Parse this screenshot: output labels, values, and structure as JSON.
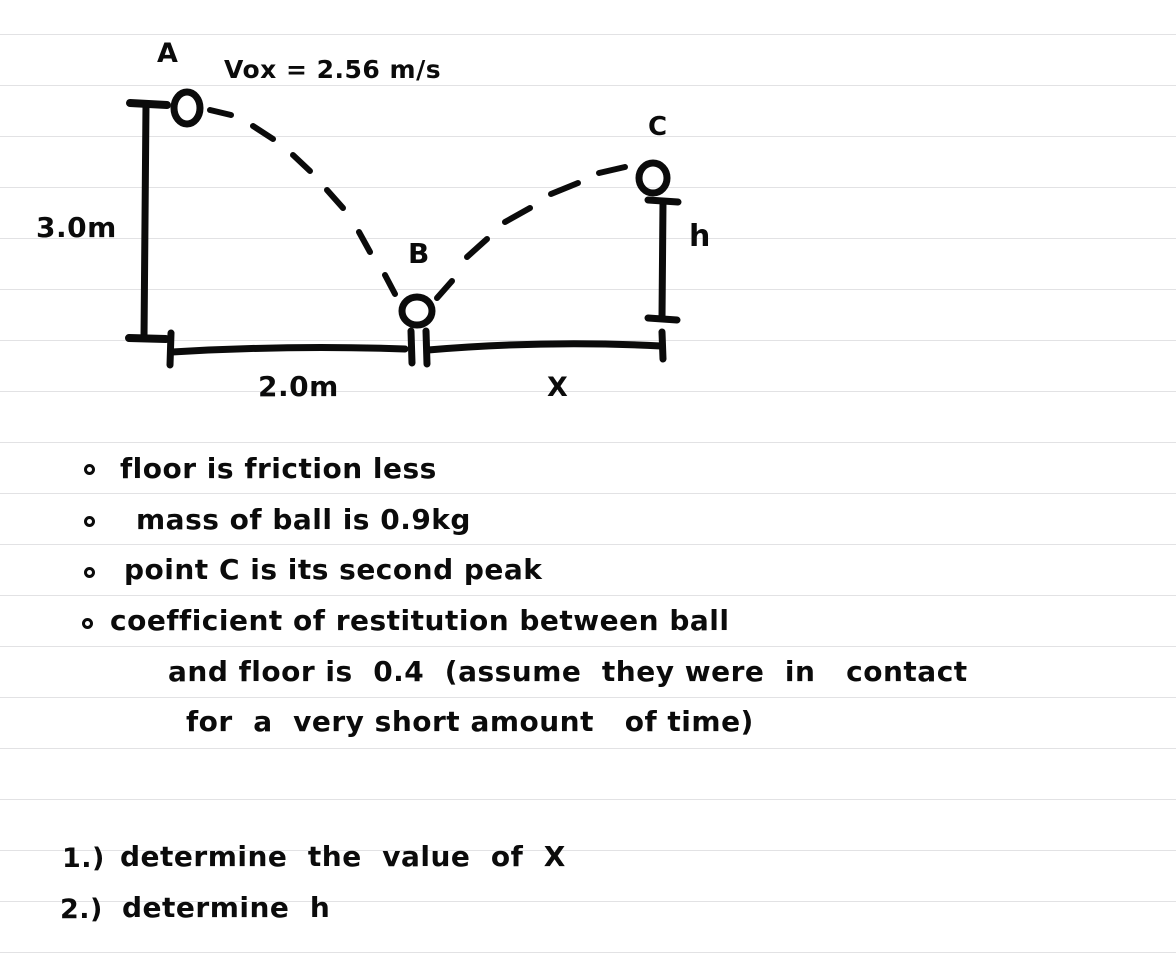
{
  "document": {
    "kind": "handwritten-notebook-page",
    "background_color": "#ffffff",
    "ink_color": "#0b0b0b",
    "rule_color": "#e2e2e4",
    "rule_spacing_px": 51
  },
  "diagram": {
    "title": "projectile bouncing off frictionless floor",
    "labels": {
      "point_a": "A",
      "point_b": "B",
      "point_c": "C",
      "initial_velocity": "Vox = 2.56 m/s",
      "drop_height": "3.0m",
      "horizontal_run_ab": "2.0m",
      "horizontal_run_bc": "X",
      "bounce_height": "h"
    },
    "balls": [
      {
        "name": "ball-a",
        "label": "A"
      },
      {
        "name": "ball-b",
        "label": "B"
      },
      {
        "name": "ball-c",
        "label": "C"
      }
    ]
  },
  "given": {
    "heading": "",
    "bullets": [
      "floor is friction less",
      "mass of ball is 0.9kg",
      "point C is its second peak",
      "coefficient of restitution between ball"
    ],
    "bullet4_lines": [
      "and floor is  0.4  (assume  they were  in   contact",
      "for  a  very short amount   of time)"
    ]
  },
  "questions": [
    {
      "number": "1.)",
      "text": "determine  the  value  of  X"
    },
    {
      "number": "2.)",
      "text": "determine  h"
    }
  ],
  "values": {
    "vox": "2.56 m/s",
    "drop_height": "3.0m",
    "run": "2.0m",
    "mass": "0.9kg",
    "restitution": "0.4"
  }
}
